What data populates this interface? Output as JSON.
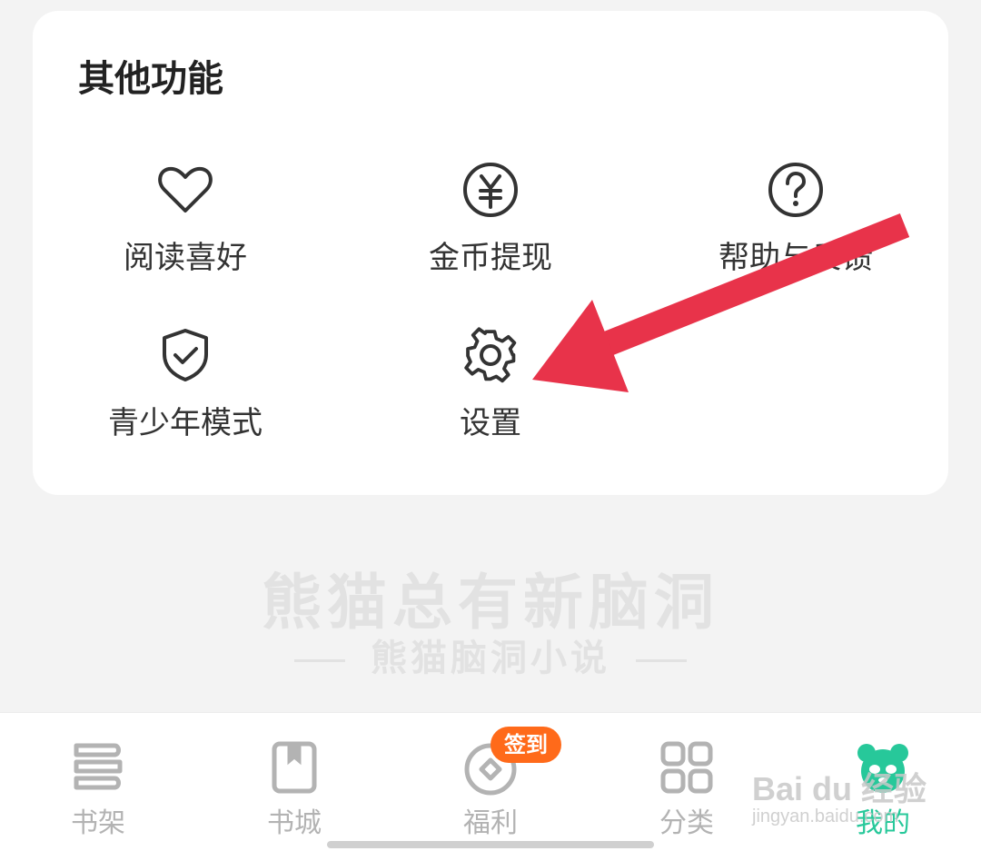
{
  "section": {
    "title": "其他功能",
    "items": [
      {
        "label": "阅读喜好",
        "icon": "heart-icon"
      },
      {
        "label": "金币提现",
        "icon": "yuan-coin-icon"
      },
      {
        "label": "帮助与反馈",
        "icon": "help-icon"
      },
      {
        "label": "青少年模式",
        "icon": "shield-check-icon"
      },
      {
        "label": "设置",
        "icon": "gear-icon"
      }
    ]
  },
  "slogan": {
    "main": "熊猫总有新脑洞",
    "sub": "熊猫脑洞小说"
  },
  "tabbar": {
    "tabs": [
      {
        "label": "书架",
        "icon": "bookshelf-icon",
        "active": false
      },
      {
        "label": "书城",
        "icon": "bookstore-icon",
        "active": false
      },
      {
        "label": "福利",
        "icon": "welfare-coin-icon",
        "active": false
      },
      {
        "label": "分类",
        "icon": "category-grid-icon",
        "active": false
      },
      {
        "label": "我的",
        "icon": "panda-icon",
        "active": true
      }
    ],
    "badge": "签到"
  },
  "watermark": {
    "brand": "Bai du 经验",
    "url": "jingyan.baidu.com"
  },
  "colors": {
    "accent": "#27c89a",
    "badge": "#ff6a1a",
    "arrow": "#e8334a"
  }
}
